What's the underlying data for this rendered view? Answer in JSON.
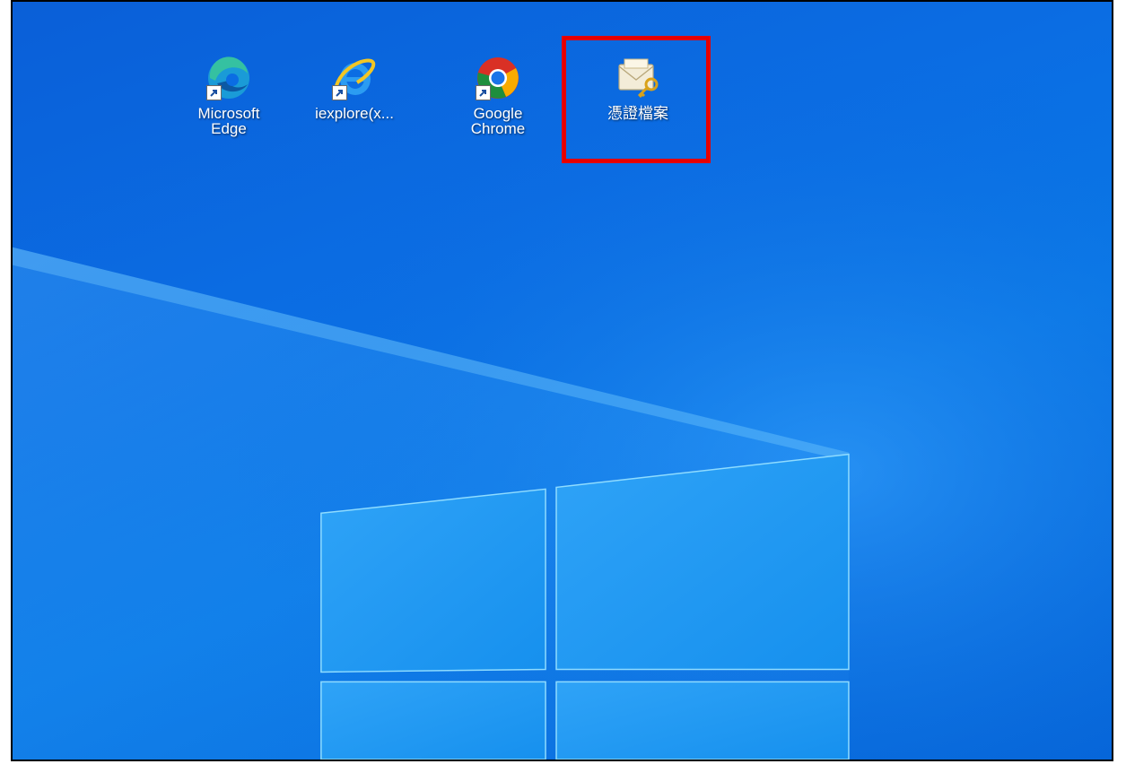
{
  "desktop": {
    "icons": [
      {
        "label": "Microsoft\nEdge",
        "icon": "edge-icon",
        "shortcut": true
      },
      {
        "label": "iexplore(x...",
        "icon": "internet-explorer-icon",
        "shortcut": true
      },
      {
        "label": "Google\nChrome",
        "icon": "chrome-icon",
        "shortcut": true
      },
      {
        "label": "憑證檔案",
        "icon": "certificate-envelope-key-icon",
        "shortcut": false
      }
    ],
    "highlight": {
      "target": "憑證檔案",
      "color": "#e60000"
    }
  },
  "colors": {
    "wallpaper": "#0b6de3",
    "highlight": "#e60000"
  }
}
